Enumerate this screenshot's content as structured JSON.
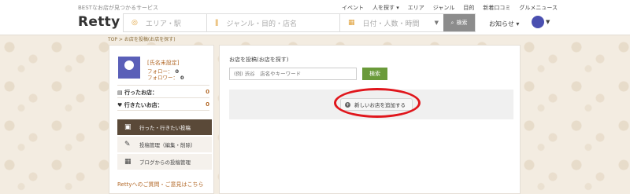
{
  "header": {
    "tagline": "BESTなお店が見つかるサービス",
    "logo": "Retty",
    "topnav": [
      "イベント",
      "人を探す ▾",
      "エリア",
      "ジャンル",
      "目的",
      "新着口コミ",
      "グルメニュース"
    ],
    "search": {
      "area_placeholder": "エリア・駅",
      "genre_placeholder": "ジャンル・目的・店名",
      "date_placeholder": "日付・人数・時間",
      "button_label": "検索"
    },
    "notify_label": "お知らせ ▾"
  },
  "breadcrumb": "TOP > お店を投稿(お店を探す)",
  "profile": {
    "name": "[氏名未設定]",
    "follow_label": "フォロー：",
    "follow_count": "0",
    "follower_label": "フォロワー：",
    "follower_count": "0"
  },
  "stats": [
    {
      "label": "行ったお店：",
      "value": "0"
    },
    {
      "label": "行きたいお店：",
      "value": "0"
    }
  ],
  "menu": [
    {
      "label": "行った・行きたい投稿"
    },
    {
      "label": "投稿管理（編集・削除）"
    },
    {
      "label": "ブログからの投稿管理"
    }
  ],
  "contact_link": "Rettyへのご質問・ご意見はこちら",
  "main": {
    "search_title": "お店を投稿(お店を探す)",
    "keyword_placeholder": "(例) 渋谷　店名やキーワード",
    "search_button": "検索",
    "add_store_button": "新しいお店を追加する"
  },
  "colors": {
    "accent_orange": "#b36a2a",
    "search_green": "#6a9a3a",
    "highlight_red": "#e0161c",
    "menu_active": "#5a4938"
  }
}
